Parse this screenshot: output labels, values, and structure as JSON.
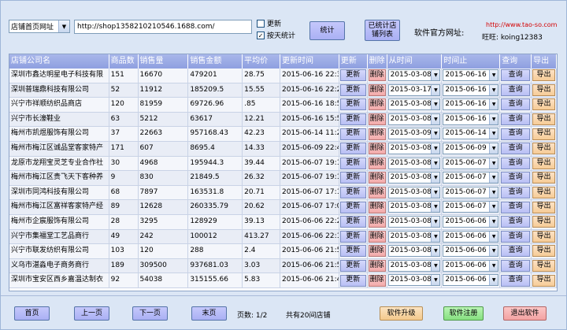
{
  "toolbar": {
    "store_select": "店铺首页网址",
    "url": "http://shop1358210210546.1688.com/",
    "update_label": "更新",
    "update_checked": false,
    "daily_label": "按天统计",
    "daily_checked": true,
    "stats_button": "统计",
    "stored_list_button_line1": "已统计店",
    "stored_list_button_line2": "铺列表",
    "official_site_label": "软件官方网址:",
    "official_site_url": "http://www.tao-so.com",
    "wangwang_label": "旺旺: koing12383"
  },
  "table": {
    "headers": [
      "店铺公司名",
      "商品数",
      "销售量",
      "销售金额",
      "平均价",
      "更新时间",
      "更新",
      "删除",
      "从时间",
      "时间止",
      "查询",
      "导出"
    ],
    "update_btn": "更新",
    "delete_btn": "删除",
    "query_btn": "查询",
    "export_btn": "导出",
    "rows": [
      {
        "name": "深圳市鑫达明星电子科技有限",
        "count": "151",
        "sales": "16670",
        "amount": "479201",
        "avg": "28.75",
        "time": "2015-06-16 22:36:5",
        "from": "2015-03-08",
        "to": "2015-06-16"
      },
      {
        "name": "深圳普瑞鼎科技有限公司",
        "count": "52",
        "sales": "11912",
        "amount": "185209.5",
        "avg": "15.55",
        "time": "2015-06-16 22:27:2",
        "from": "2015-03-17",
        "to": "2015-06-16"
      },
      {
        "name": "兴宁市祥顺纺织品商店",
        "count": "120",
        "sales": "81959",
        "amount": "69726.96",
        "avg": ".85",
        "time": "2015-06-16 18:51:0",
        "from": "2015-03-08",
        "to": "2015-06-16"
      },
      {
        "name": "兴宁市长濠鞋业",
        "count": "63",
        "sales": "5212",
        "amount": "63617",
        "avg": "12.21",
        "time": "2015-06-16 15:50:3",
        "from": "2015-03-08",
        "to": "2015-06-16"
      },
      {
        "name": "梅州市凯煜服饰有限公司",
        "count": "37",
        "sales": "22663",
        "amount": "957168.43",
        "avg": "42.23",
        "time": "2015-06-14 11:24:0",
        "from": "2015-03-09",
        "to": "2015-06-14"
      },
      {
        "name": "梅州市梅江区诚品堂客家特产",
        "count": "171",
        "sales": "607",
        "amount": "8695.4",
        "avg": "14.33",
        "time": "2015-06-09 22:40:4",
        "from": "2015-03-08",
        "to": "2015-06-09"
      },
      {
        "name": "龙原市龙翔宝灵芝专业合作社",
        "count": "30",
        "sales": "4968",
        "amount": "195944.3",
        "avg": "39.44",
        "time": "2015-06-07 19:13:2",
        "from": "2015-03-08",
        "to": "2015-06-07"
      },
      {
        "name": "梅州市梅江区贵飞天下客种养",
        "count": "9",
        "sales": "830",
        "amount": "21849.5",
        "avg": "26.32",
        "time": "2015-06-07 19:10:3",
        "from": "2015-03-08",
        "to": "2015-06-07"
      },
      {
        "name": "深圳市同鸿科技有限公司",
        "count": "68",
        "sales": "7897",
        "amount": "163531.8",
        "avg": "20.71",
        "time": "2015-06-07 17:11:0",
        "from": "2015-03-08",
        "to": "2015-06-07"
      },
      {
        "name": "梅州市梅江区富祥客家特产经",
        "count": "89",
        "sales": "12628",
        "amount": "260335.79",
        "avg": "20.62",
        "time": "2015-06-07 17:07:1",
        "from": "2015-03-08",
        "to": "2015-06-07"
      },
      {
        "name": "梅州市企宸服饰有限公司",
        "count": "28",
        "sales": "3295",
        "amount": "128929",
        "avg": "39.13",
        "time": "2015-06-06 22:23:4",
        "from": "2015-03-08",
        "to": "2015-06-06"
      },
      {
        "name": "兴宁市集福堂工艺品商行",
        "count": "49",
        "sales": "242",
        "amount": "100012",
        "avg": "413.27",
        "time": "2015-06-06 22:17:5",
        "from": "2015-03-08",
        "to": "2015-06-06"
      },
      {
        "name": "兴宁市联发纺织有限公司",
        "count": "103",
        "sales": "120",
        "amount": "288",
        "avg": "2.4",
        "time": "2015-06-06 21:57:0",
        "from": "2015-03-08",
        "to": "2015-06-06"
      },
      {
        "name": "义乌市湛淼电子商务商行",
        "count": "189",
        "sales": "309500",
        "amount": "937681.03",
        "avg": "3.03",
        "time": "2015-06-06 21:50:4",
        "from": "2015-03-08",
        "to": "2015-06-06"
      },
      {
        "name": "深圳市宝安区西乡嘉温达制衣",
        "count": "92",
        "sales": "54038",
        "amount": "315155.66",
        "avg": "5.83",
        "time": "2015-06-06 21:46:3",
        "from": "2015-03-08",
        "to": "2015-06-06"
      }
    ]
  },
  "footer": {
    "first_page": "首页",
    "prev_page": "上一页",
    "next_page": "下一页",
    "last_page": "末页",
    "page_info": "页数: 1/2",
    "total_info": "共有20间店铺",
    "upgrade": "软件升级",
    "register": "软件注册",
    "exit": "退出软件"
  }
}
